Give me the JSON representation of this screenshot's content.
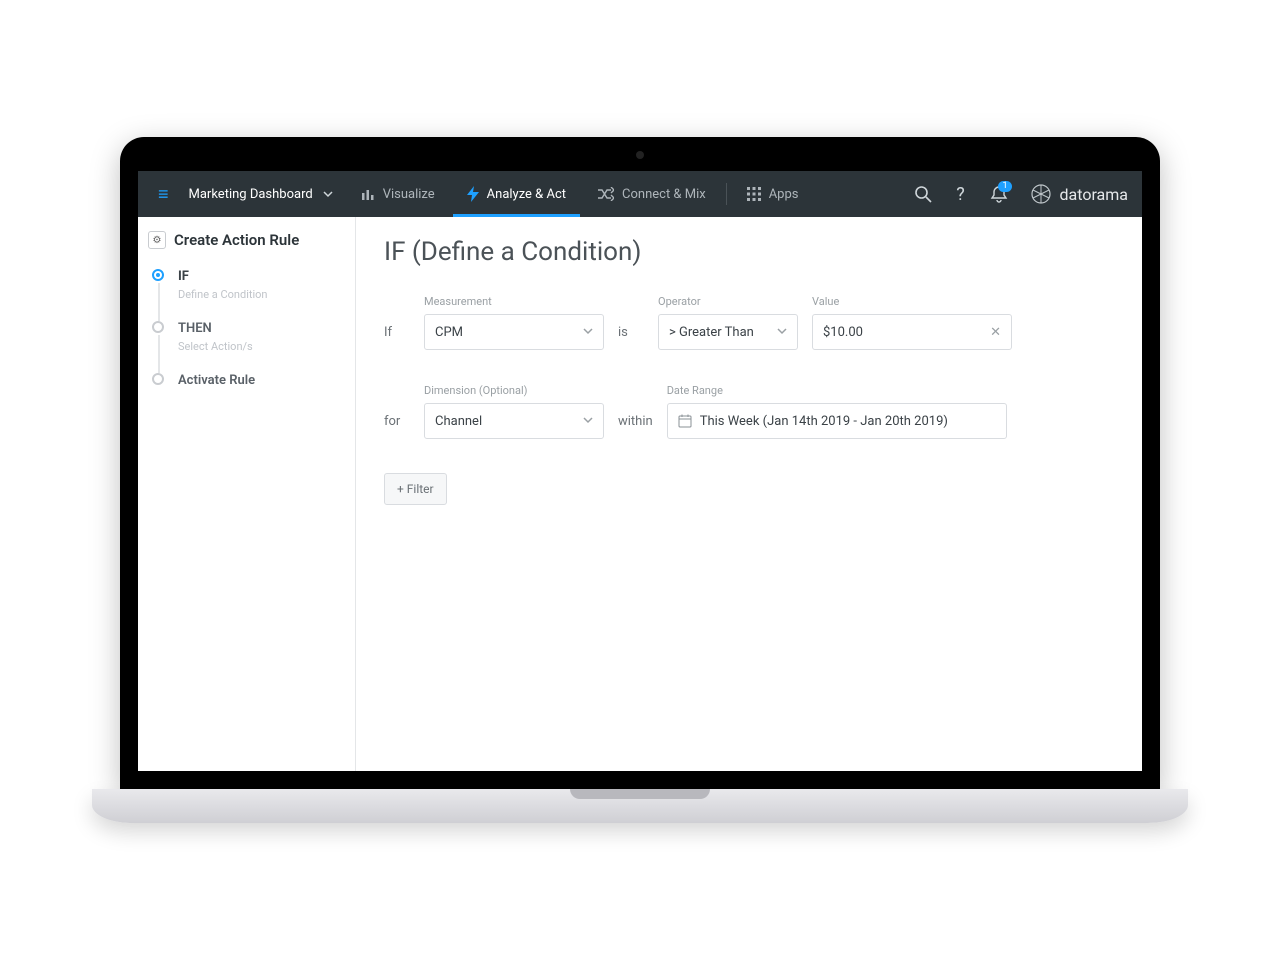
{
  "nav": {
    "dashboard": "Marketing Dashboard",
    "visualize": "Visualize",
    "analyze": "Analyze & Act",
    "connect": "Connect & Mix",
    "apps": "Apps",
    "notif_badge": "1"
  },
  "brand": "datorama",
  "sidebar": {
    "title": "Create Action Rule",
    "steps": [
      {
        "label": "IF",
        "sub": "Define a Condition"
      },
      {
        "label": "THEN",
        "sub": "Select Action/s"
      },
      {
        "label": "Activate Rule",
        "sub": ""
      }
    ]
  },
  "page": {
    "title": "IF (Define a Condition)"
  },
  "row1": {
    "kw_if": "If",
    "measurement_label": "Measurement",
    "measurement_value": "CPM",
    "kw_is": "is",
    "operator_label": "Operator",
    "operator_value": "> Greater Than",
    "value_label": "Value",
    "value_value": "$10.00"
  },
  "row2": {
    "kw_for": "for",
    "dimension_label": "Dimension (Optional)",
    "dimension_value": "Channel",
    "kw_within": "within",
    "daterange_label": "Date Range",
    "daterange_value": "This Week (Jan 14th 2019 - Jan 20th 2019)"
  },
  "add_filter": "+ Filter"
}
